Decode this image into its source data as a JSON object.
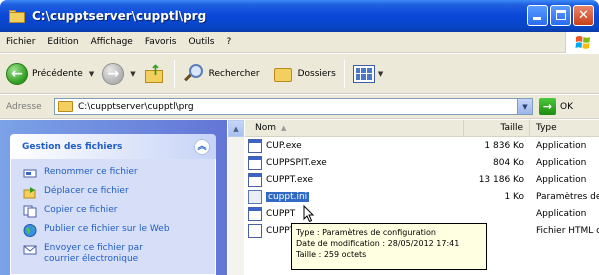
{
  "window": {
    "title": "C:\\cupptserver\\cupptl\\prg"
  },
  "menu": {
    "items": [
      "Fichier",
      "Edition",
      "Affichage",
      "Favoris",
      "Outils",
      "?"
    ]
  },
  "toolbar": {
    "back_label": "Précédente",
    "search_label": "Rechercher",
    "folders_label": "Dossiers"
  },
  "address": {
    "label": "Adresse",
    "value": "C:\\cupptserver\\cupptl\\prg",
    "go_label": "OK"
  },
  "task_pane": {
    "title": "Gestion des fichiers",
    "items": [
      {
        "label": "Renommer ce fichier",
        "icon": "rename-icon"
      },
      {
        "label": "Déplacer ce fichier",
        "icon": "move-icon"
      },
      {
        "label": "Copier ce fichier",
        "icon": "copy-icon"
      },
      {
        "label": "Publier ce fichier sur le Web",
        "icon": "globe-icon"
      },
      {
        "label": "Envoyer ce fichier par",
        "label2": "courrier électronique",
        "icon": "mail-icon"
      }
    ]
  },
  "file_list": {
    "columns": {
      "name": "Nom",
      "size": "Taille",
      "type": "Type"
    },
    "rows": [
      {
        "name": "CUP.exe",
        "size": "1 836 Ko",
        "type": "Application",
        "icon": "exe-icon"
      },
      {
        "name": "CUPPSPIT.exe",
        "size": "804 Ko",
        "type": "Application",
        "icon": "exe-icon"
      },
      {
        "name": "CUPPT.exe",
        "size": "13 186 Ko",
        "type": "Application",
        "icon": "exe-icon"
      },
      {
        "name": "cuppt.ini",
        "size": "1 Ko",
        "type": "Paramètres de c",
        "icon": "ini-icon",
        "selected": true
      },
      {
        "name": "CUPPT",
        "size": "",
        "type": "Application",
        "icon": "exe-icon"
      },
      {
        "name": "CUPPT",
        "size": "",
        "type": "Fichier HTML cor",
        "icon": "htm-icon"
      }
    ]
  },
  "tooltip": {
    "line1": "Type : Paramètres de configuration",
    "line2": "Date de modification : 28/05/2012 17:41",
    "line3": "Taille : 259 octets"
  },
  "colors": {
    "titlebar": "#0a47d8",
    "task_link": "#215dc6",
    "selection": "#316ac5",
    "tooltip_bg": "#ffffe1"
  }
}
